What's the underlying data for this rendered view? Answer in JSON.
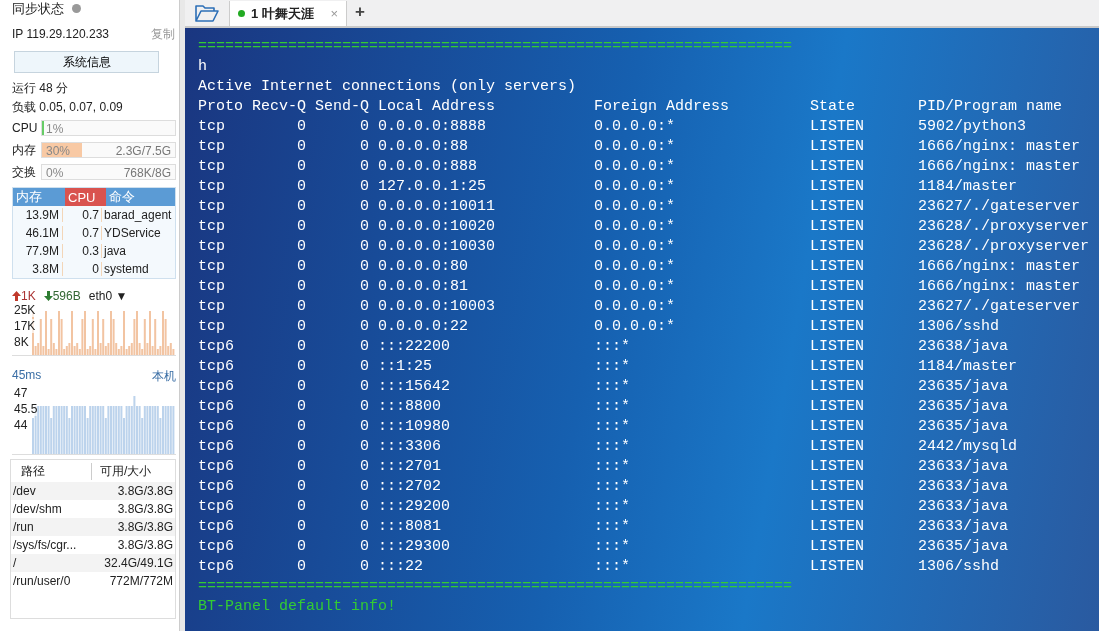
{
  "sidebar": {
    "sync_status": "同步状态",
    "ip_label": "IP",
    "ip": "119.29.120.233",
    "copy_link": "复制",
    "sysinfo_button": "系统信息",
    "uptime": "运行 48 分",
    "load": "负载 0.05, 0.07, 0.09",
    "meters": [
      {
        "label": "CPU",
        "value": "1%",
        "level": 0.01
      },
      {
        "label": "内存",
        "value": "30%",
        "detail": "2.3G/7.5G",
        "level": 0.3
      },
      {
        "label": "交换",
        "value": "0%",
        "detail": "768K/8G",
        "level": 0
      }
    ],
    "processes": {
      "columns": [
        {
          "label": "内存",
          "color": "#5b9bd5"
        },
        {
          "label": "CPU",
          "color": "#d9534f"
        },
        {
          "label": "命令",
          "color": "#5b9bd5"
        }
      ],
      "rows": [
        [
          "13.9M",
          "0.7",
          "barad_agent"
        ],
        [
          "46.1M",
          "0.7",
          "YDService"
        ],
        [
          "77.9M",
          "0.3",
          "java"
        ],
        [
          "3.8M",
          "0",
          "systemd"
        ]
      ]
    },
    "network": {
      "up": "1K",
      "down": "596B",
      "interface": "eth0",
      "dropdown_glyph": "▼",
      "yticks": [
        "25K",
        "17K",
        "8K"
      ]
    },
    "ping": {
      "latency": "45ms",
      "host": "本机",
      "yticks": [
        "47",
        "45.5",
        "44"
      ]
    },
    "disks": {
      "columns": [
        "路径",
        "可用/大小"
      ],
      "rows": [
        [
          "/dev",
          "3.8G/3.8G"
        ],
        [
          "/dev/shm",
          "3.8G/3.8G"
        ],
        [
          "/run",
          "3.8G/3.8G"
        ],
        [
          "/sys/fs/cgr...",
          "3.8G/3.8G"
        ],
        [
          "/",
          "32.4G/49.1G"
        ],
        [
          "/run/user/0",
          "772M/772M"
        ]
      ]
    }
  },
  "tabs": [
    {
      "number": "1",
      "label": "叶舞天涯",
      "close_glyph": "×",
      "selected": true
    }
  ],
  "new_tab_glyph": "+",
  "terminal": {
    "lines": [
      {
        "kind": "rule",
        "text": "=================================================================="
      },
      {
        "kind": "text",
        "text": "h"
      },
      {
        "kind": "text",
        "text": "Active Internet connections (only servers)"
      },
      {
        "kind": "header",
        "cells": [
          "Proto",
          "Recv-Q",
          "Send-Q",
          "Local Address",
          "Foreign Address",
          "State",
          "PID/Program name"
        ]
      },
      {
        "kind": "row",
        "cells": [
          "tcp",
          "0",
          "0",
          "0.0.0.0:8888",
          "0.0.0.0:*",
          "LISTEN",
          "5902/python3"
        ]
      },
      {
        "kind": "row",
        "cells": [
          "tcp",
          "0",
          "0",
          "0.0.0.0:88",
          "0.0.0.0:*",
          "LISTEN",
          "1666/nginx: master"
        ]
      },
      {
        "kind": "row",
        "cells": [
          "tcp",
          "0",
          "0",
          "0.0.0.0:888",
          "0.0.0.0:*",
          "LISTEN",
          "1666/nginx: master"
        ]
      },
      {
        "kind": "row",
        "cells": [
          "tcp",
          "0",
          "0",
          "127.0.0.1:25",
          "0.0.0.0:*",
          "LISTEN",
          "1184/master"
        ]
      },
      {
        "kind": "row",
        "cells": [
          "tcp",
          "0",
          "0",
          "0.0.0.0:10011",
          "0.0.0.0:*",
          "LISTEN",
          "23627/./gateserver"
        ]
      },
      {
        "kind": "row",
        "cells": [
          "tcp",
          "0",
          "0",
          "0.0.0.0:10020",
          "0.0.0.0:*",
          "LISTEN",
          "23628/./proxyserver"
        ]
      },
      {
        "kind": "row",
        "cells": [
          "tcp",
          "0",
          "0",
          "0.0.0.0:10030",
          "0.0.0.0:*",
          "LISTEN",
          "23628/./proxyserver"
        ]
      },
      {
        "kind": "row",
        "cells": [
          "tcp",
          "0",
          "0",
          "0.0.0.0:80",
          "0.0.0.0:*",
          "LISTEN",
          "1666/nginx: master"
        ]
      },
      {
        "kind": "row",
        "cells": [
          "tcp",
          "0",
          "0",
          "0.0.0.0:81",
          "0.0.0.0:*",
          "LISTEN",
          "1666/nginx: master"
        ]
      },
      {
        "kind": "row",
        "cells": [
          "tcp",
          "0",
          "0",
          "0.0.0.0:10003",
          "0.0.0.0:*",
          "LISTEN",
          "23627/./gateserver"
        ]
      },
      {
        "kind": "row",
        "cells": [
          "tcp",
          "0",
          "0",
          "0.0.0.0:22",
          "0.0.0.0:*",
          "LISTEN",
          "1306/sshd"
        ]
      },
      {
        "kind": "row",
        "cells": [
          "tcp6",
          "0",
          "0",
          ":::22200",
          ":::*",
          "LISTEN",
          "23638/java"
        ]
      },
      {
        "kind": "row",
        "cells": [
          "tcp6",
          "0",
          "0",
          "::1:25",
          ":::*",
          "LISTEN",
          "1184/master"
        ]
      },
      {
        "kind": "row",
        "cells": [
          "tcp6",
          "0",
          "0",
          ":::15642",
          ":::*",
          "LISTEN",
          "23635/java"
        ]
      },
      {
        "kind": "row",
        "cells": [
          "tcp6",
          "0",
          "0",
          ":::8800",
          ":::*",
          "LISTEN",
          "23635/java"
        ]
      },
      {
        "kind": "row",
        "cells": [
          "tcp6",
          "0",
          "0",
          ":::10980",
          ":::*",
          "LISTEN",
          "23635/java"
        ]
      },
      {
        "kind": "row",
        "cells": [
          "tcp6",
          "0",
          "0",
          ":::3306",
          ":::*",
          "LISTEN",
          "2442/mysqld"
        ]
      },
      {
        "kind": "row",
        "cells": [
          "tcp6",
          "0",
          "0",
          ":::2701",
          ":::*",
          "LISTEN",
          "23633/java"
        ]
      },
      {
        "kind": "row",
        "cells": [
          "tcp6",
          "0",
          "0",
          ":::2702",
          ":::*",
          "LISTEN",
          "23633/java"
        ]
      },
      {
        "kind": "row",
        "cells": [
          "tcp6",
          "0",
          "0",
          ":::29200",
          ":::*",
          "LISTEN",
          "23633/java"
        ]
      },
      {
        "kind": "row",
        "cells": [
          "tcp6",
          "0",
          "0",
          ":::8081",
          ":::*",
          "LISTEN",
          "23633/java"
        ]
      },
      {
        "kind": "row",
        "cells": [
          "tcp6",
          "0",
          "0",
          ":::29300",
          ":::*",
          "LISTEN",
          "23635/java"
        ]
      },
      {
        "kind": "row",
        "cells": [
          "tcp6",
          "0",
          "0",
          ":::22",
          ":::*",
          "LISTEN",
          "1306/sshd"
        ]
      },
      {
        "kind": "rule",
        "text": "=================================================================="
      },
      {
        "kind": "info",
        "text": "BT-Panel default info!"
      }
    ]
  }
}
